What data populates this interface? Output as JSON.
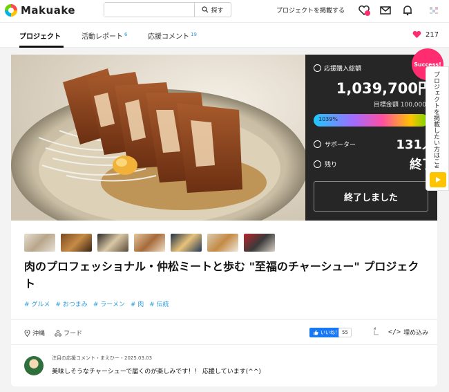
{
  "header": {
    "logo_text": "Makuake",
    "search_placeholder": "",
    "search_button": "探す",
    "post_project": "プロジェクトを掲載する"
  },
  "tabs": [
    {
      "label": "プロジェクト",
      "count": ""
    },
    {
      "label": "活動レポート",
      "count": "6"
    },
    {
      "label": "応援コメント",
      "count": "19"
    }
  ],
  "likes_count": "217",
  "funding": {
    "label": "応援購入総額",
    "amount": "1,039,700円",
    "goal": "目標金額 100,000円",
    "percent_text": "1039%",
    "supporters_label": "サポーター",
    "supporters_value": "131人",
    "remaining_label": "残り",
    "remaining_value": "終了",
    "ended_button": "終了しました",
    "success_badge": "Success!"
  },
  "sidebar": {
    "text": "プロジェクトを掲載したい方はこちら"
  },
  "project": {
    "title": "肉のプロフェッショナル・仲松ミートと歩む \"至福のチャーシュー\" プロジェクト",
    "tags": [
      "# グルメ",
      "# おつまみ",
      "# ラーメン",
      "# 肉",
      "# 伝統"
    ],
    "location": "沖縄",
    "category": "フード",
    "fb_like": "いいね！",
    "fb_count": "55",
    "embed": "埋め込み"
  },
  "comment": {
    "header": "注目の応援コメント・まえひー・2025.03.03",
    "body": "美味しそうなチャーシューで届くのが楽しみです！！ 応援しています(^^)"
  },
  "colors": {
    "accent_pink": "#ff2d6f",
    "link_blue": "#2b9bd8",
    "panel_dark": "#262626",
    "sidebar_yellow": "#ffc400",
    "fb_blue": "#1877f2"
  }
}
